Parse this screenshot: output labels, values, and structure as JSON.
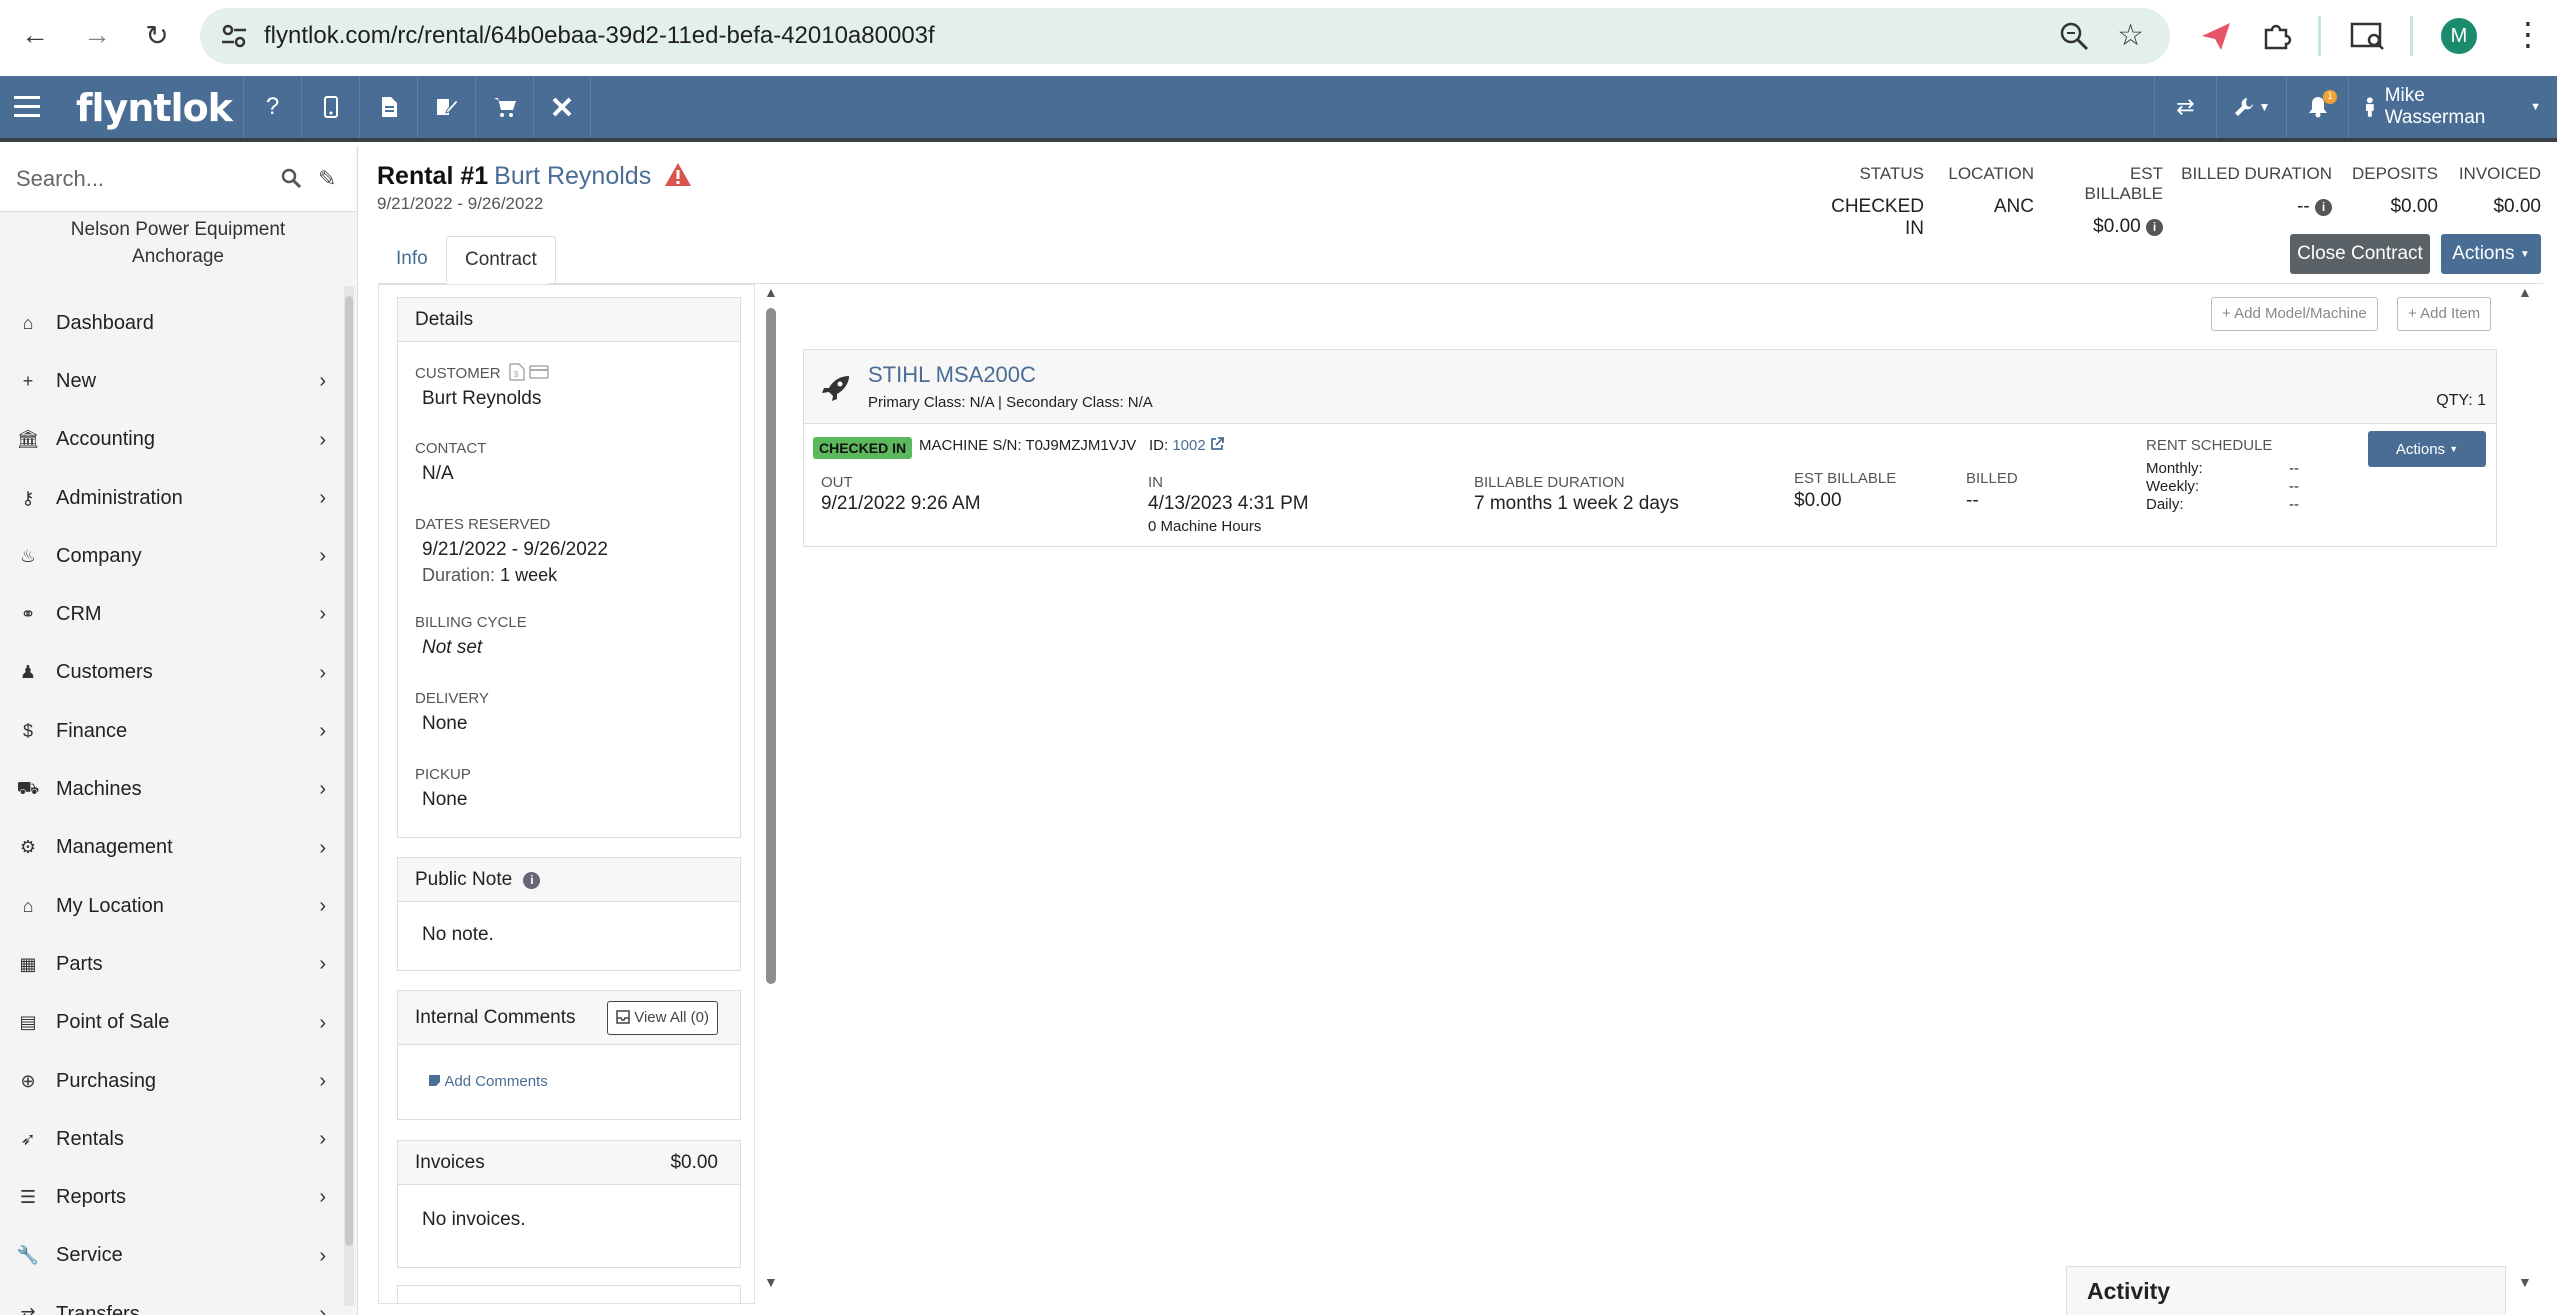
{
  "browser": {
    "url": "flyntlok.com/rc/rental/64b0ebaa-39d2-11ed-befa-42010a80003f",
    "avatar_letter": "M"
  },
  "appbar": {
    "logo": "flyntlok",
    "user_name": "Mike Wasserman",
    "notification_count": "1"
  },
  "sidebar": {
    "search_placeholder": "Search...",
    "company_name": "Nelson Power Equipment",
    "location_name": "Anchorage",
    "items": [
      {
        "label": "Dashboard",
        "icon": "home-icon"
      },
      {
        "label": "New",
        "icon": "plus-icon"
      },
      {
        "label": "Accounting",
        "icon": "bank-icon"
      },
      {
        "label": "Administration",
        "icon": "key-icon"
      },
      {
        "label": "Company",
        "icon": "fire-icon"
      },
      {
        "label": "CRM",
        "icon": "handshake-icon"
      },
      {
        "label": "Customers",
        "icon": "person-icon"
      },
      {
        "label": "Finance",
        "icon": "dollar-icon"
      },
      {
        "label": "Machines",
        "icon": "tractor-icon"
      },
      {
        "label": "Management",
        "icon": "gear-icon"
      },
      {
        "label": "My Location",
        "icon": "home-icon"
      },
      {
        "label": "Parts",
        "icon": "boxes-icon"
      },
      {
        "label": "Point of Sale",
        "icon": "cash-register-icon"
      },
      {
        "label": "Purchasing",
        "icon": "crosshair-icon"
      },
      {
        "label": "Rentals",
        "icon": "rocket-icon"
      },
      {
        "label": "Reports",
        "icon": "list-icon"
      },
      {
        "label": "Service",
        "icon": "wrench-icon"
      },
      {
        "label": "Transfers",
        "icon": "exchange-icon"
      }
    ]
  },
  "header": {
    "rental_label": "Rental #1",
    "customer_name": "Burt Reynolds",
    "dates": "9/21/2022 - 9/26/2022",
    "stats": [
      {
        "label": "STATUS",
        "value": "CHECKED IN"
      },
      {
        "label": "LOCATION",
        "value": "ANC"
      },
      {
        "label": "EST BILLABLE",
        "value": "$0.00"
      },
      {
        "label": "BILLED DURATION",
        "value": "--"
      },
      {
        "label": "DEPOSITS",
        "value": "$0.00"
      },
      {
        "label": "INVOICED",
        "value": "$0.00"
      }
    ],
    "close_contract_label": "Close Contract",
    "actions_label": "Actions"
  },
  "tabs": {
    "info": "Info",
    "contract": "Contract"
  },
  "details": {
    "title": "Details",
    "customer_label": "CUSTOMER",
    "customer_value": "Burt Reynolds",
    "contact_label": "CONTACT",
    "contact_value": "N/A",
    "dates_label": "DATES RESERVED",
    "dates_value": "9/21/2022 - 9/26/2022",
    "duration_label": "Duration:",
    "duration_value": "1 week",
    "billing_label": "BILLING CYCLE",
    "billing_value": "Not set",
    "delivery_label": "DELIVERY",
    "delivery_value": "None",
    "pickup_label": "PICKUP",
    "pickup_value": "None"
  },
  "public_note": {
    "title": "Public Note",
    "body": "No note."
  },
  "internal_comments": {
    "title": "Internal Comments",
    "view_all": "View All (0)",
    "add_link": "Add Comments"
  },
  "invoices": {
    "title": "Invoices",
    "total": "$0.00",
    "body": "No invoices."
  },
  "contract": {
    "add_model_label": "Add Model/Machine",
    "add_item_label": "Add Item",
    "machine": {
      "name": "STIHL MSA200C",
      "classes": "Primary Class: N/A | Secondary Class: N/A",
      "qty_label": "QTY:",
      "qty": "1",
      "status": "CHECKED IN",
      "serial": "MACHINE S/N: T0J9MZJM1VJV",
      "id_label": "ID:",
      "id_value": "1002",
      "out_label": "OUT",
      "out_value": "9/21/2022 9:26 AM",
      "in_label": "IN",
      "in_value": "4/13/2023 4:31 PM",
      "machine_hours": "0 Machine Hours",
      "billable_duration_label": "BILLABLE DURATION",
      "billable_duration_value": "7 months 1 week 2 days",
      "est_billable_label": "EST BILLABLE",
      "est_billable_value": "$0.00",
      "billed_label": "BILLED",
      "billed_value": "--",
      "rent_schedule_label": "RENT SCHEDULE",
      "monthly_label": "Monthly:",
      "monthly_value": "--",
      "weekly_label": "Weekly:",
      "weekly_value": "--",
      "daily_label": "Daily:",
      "daily_value": "--",
      "actions_label": "Actions"
    }
  },
  "activity": {
    "title": "Activity"
  },
  "colors": {
    "primary": "#4a6d96",
    "success": "#5cb85c",
    "danger": "#d9534f"
  }
}
